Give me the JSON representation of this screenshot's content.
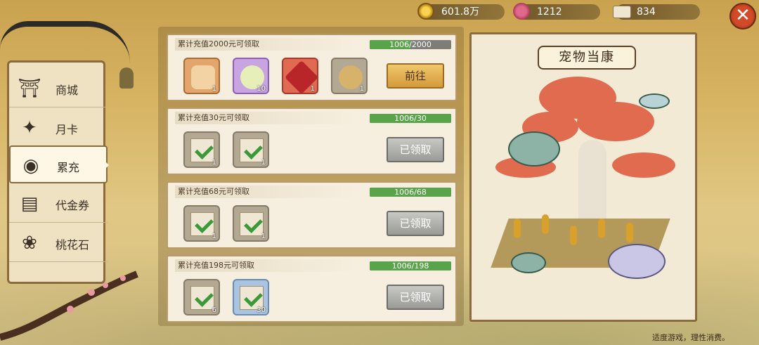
{
  "resources": {
    "coins": "601.8万",
    "gems": "1212",
    "tickets": "834"
  },
  "close_label": "✕",
  "menu": [
    {
      "label": "商城",
      "icon": "shop-icon",
      "active": false
    },
    {
      "label": "月卡",
      "icon": "monthly-card-icon",
      "active": false
    },
    {
      "label": "累充",
      "icon": "money-bag-icon",
      "active": true
    },
    {
      "label": "代金券",
      "icon": "voucher-icon",
      "active": false
    },
    {
      "label": "桃花石",
      "icon": "peach-stone-icon",
      "active": false
    }
  ],
  "rewards": [
    {
      "title": "累计充值2000元可领取",
      "progress": "1006/2000",
      "progress_fraction": 0.503,
      "items": [
        {
          "name": "character-scroll-icon",
          "quality": "orange",
          "count": "1"
        },
        {
          "name": "dumpling-icon",
          "quality": "purple",
          "count": "10"
        },
        {
          "name": "red-crystal-icon",
          "quality": "red",
          "count": "1"
        },
        {
          "name": "refresh-bag-icon",
          "quality": "gray",
          "count": "1"
        }
      ],
      "button": "前往",
      "button_state": "go"
    },
    {
      "title": "累计充值30元可领取",
      "progress": "1006/30",
      "progress_fraction": 1,
      "items": [
        {
          "name": "claimed-check-icon",
          "quality": "gray",
          "count": "1"
        },
        {
          "name": "claimed-check-icon",
          "quality": "gray",
          "count": "1"
        }
      ],
      "button": "已领取",
      "button_state": "done"
    },
    {
      "title": "累计充值68元可领取",
      "progress": "1006/68",
      "progress_fraction": 1,
      "items": [
        {
          "name": "claimed-check-icon",
          "quality": "gray",
          "count": "1"
        },
        {
          "name": "claimed-check-icon",
          "quality": "gray",
          "count": "1"
        }
      ],
      "button": "已领取",
      "button_state": "done"
    },
    {
      "title": "累计充值198元可领取",
      "progress": "1006/198",
      "progress_fraction": 1,
      "items": [
        {
          "name": "claimed-check-icon",
          "quality": "gray",
          "count": "6"
        },
        {
          "name": "claimed-check-icon",
          "quality": "blue",
          "count": "30"
        }
      ],
      "button": "已领取",
      "button_state": "done"
    }
  ],
  "showcase_title": "宠物当康",
  "footnote": "适度游戏，理性消费。",
  "colors": {
    "progress_fill": "#59a44a",
    "accent": "#d24a28"
  }
}
